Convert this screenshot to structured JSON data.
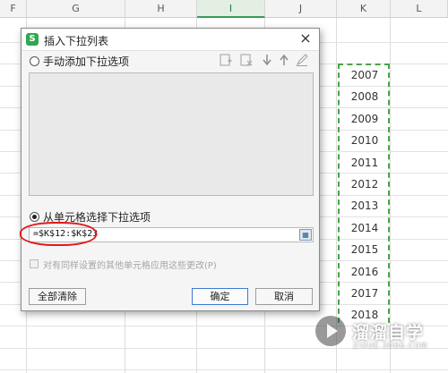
{
  "sheet": {
    "columns": [
      {
        "label": "F",
        "active": false
      },
      {
        "label": "G",
        "active": false
      },
      {
        "label": "H",
        "active": false
      },
      {
        "label": "I",
        "active": true
      },
      {
        "label": "J",
        "active": false
      },
      {
        "label": "K",
        "active": false
      },
      {
        "label": "L",
        "active": false
      }
    ],
    "k_values": [
      "2007",
      "2008",
      "2009",
      "2010",
      "2011",
      "2012",
      "2013",
      "2014",
      "2015",
      "2016",
      "2017",
      "2018"
    ],
    "selection_color": "#4aa347"
  },
  "dialog": {
    "title": "插入下拉列表",
    "app_icon_letter": "S",
    "close_glyph": "×",
    "manual_option_label": "手动添加下拉选项",
    "manual_option_selected": false,
    "toolbar_icons": [
      "add-item-icon",
      "delete-item-icon",
      "move-down-icon",
      "move-up-icon",
      "edit-icon"
    ],
    "cell_option_label": "从单元格选择下拉选项",
    "cell_option_selected": true,
    "range_value": "=$K$12:$K$23",
    "apply_same_settings_label": "对有同样设置的其他单元格应用这些更改(P)",
    "apply_same_settings_checked": false,
    "clear_all_label": "全部清除",
    "ok_label": "确定",
    "cancel_label": "取消"
  },
  "watermark": {
    "text": "溜溜自学",
    "url": "ZIXUE.3D66.COM"
  }
}
